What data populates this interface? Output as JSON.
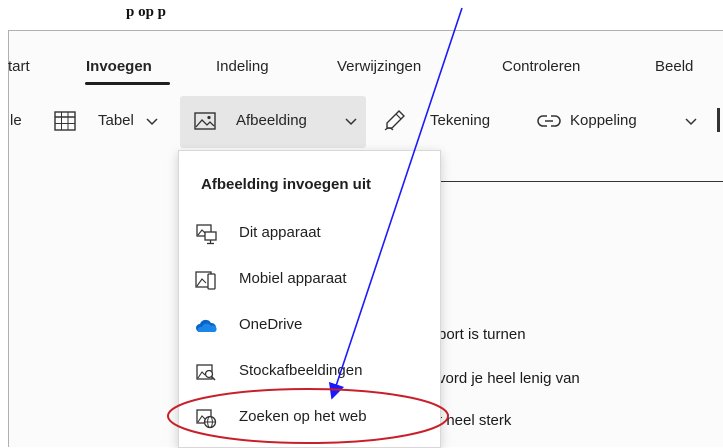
{
  "top_text": "p   op   p",
  "ribbon": {
    "tabs": [
      {
        "label": "tart"
      },
      {
        "label": "Invoegen"
      },
      {
        "label": "Indeling"
      },
      {
        "label": "Verwijzingen"
      },
      {
        "label": "Controleren"
      },
      {
        "label": "Beeld"
      }
    ],
    "active_tab": "Invoegen"
  },
  "toolbar": {
    "clipped_label": "le",
    "table_label": "Tabel",
    "image_label": "Afbeelding",
    "drawing_label": "Tekening",
    "link_label": "Koppeling"
  },
  "menu": {
    "header": "Afbeelding invoegen uit",
    "items": [
      {
        "label": "Dit apparaat",
        "icon": "device-image-icon"
      },
      {
        "label": "Mobiel apparaat",
        "icon": "mobile-image-icon"
      },
      {
        "label": "OneDrive",
        "icon": "onedrive-cloud-icon"
      },
      {
        "label": "Stockafbeeldingen",
        "icon": "stock-images-icon"
      },
      {
        "label": "Zoeken op het web",
        "icon": "web-image-search-icon"
      }
    ]
  },
  "document": {
    "lines": [
      "port is turnen",
      "vord je heel lenig van",
      "t heel sterk"
    ]
  },
  "annotation": {
    "arrow_color": "#1a1aff",
    "circle_color": "#c8202a"
  }
}
